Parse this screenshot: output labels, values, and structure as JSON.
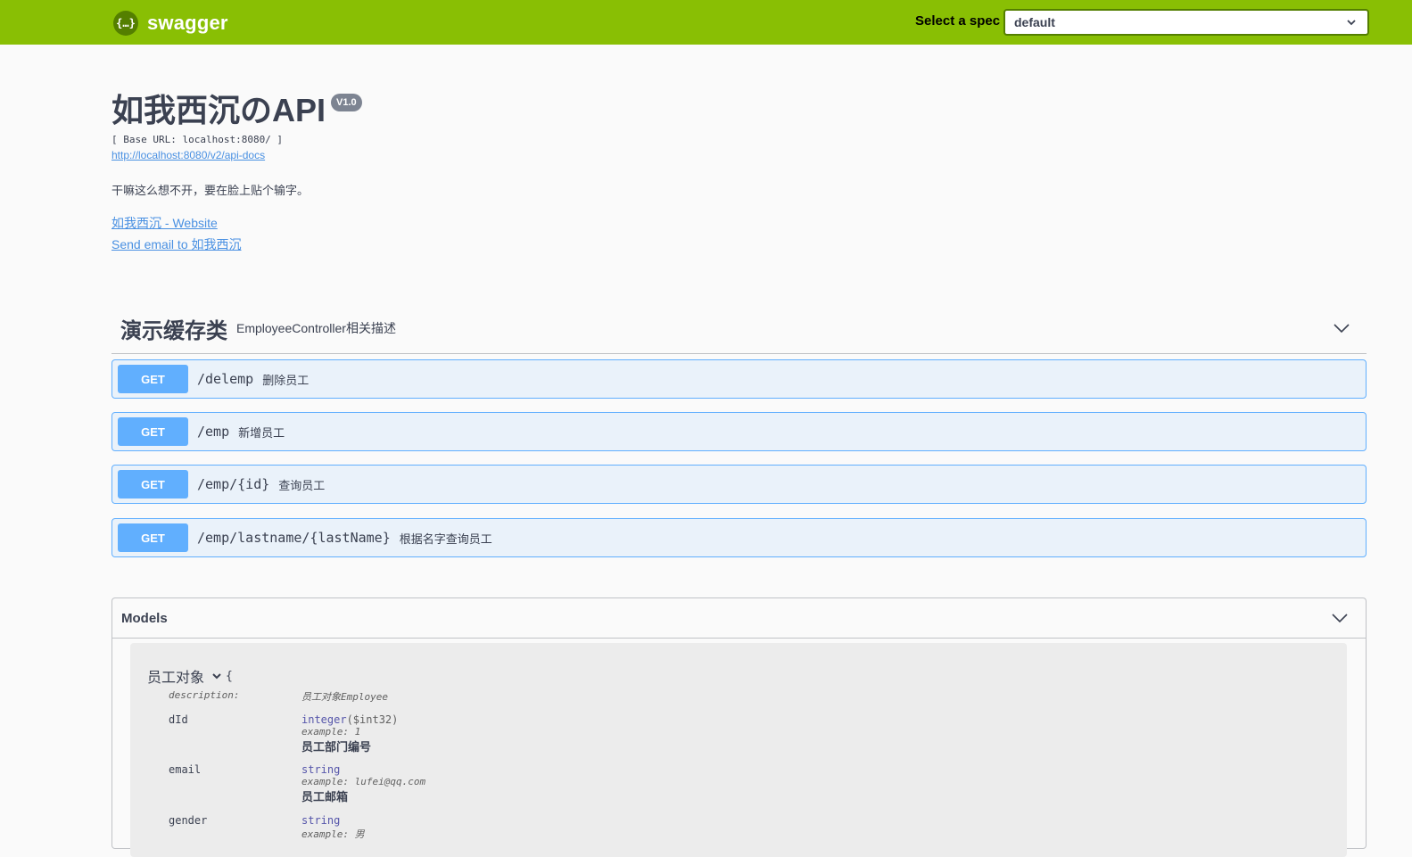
{
  "topbar": {
    "logo_symbol": "{…}",
    "logo_text": "swagger",
    "spec_label": "Select a spec",
    "spec_value": "default"
  },
  "info": {
    "title": "如我西沉のAPI",
    "version": "V1.0",
    "base_url": "[ Base URL: localhost:8080/ ]",
    "api_docs_link": "http://localhost:8080/v2/api-docs",
    "description": "干嘛这么想不开，要在脸上贴个输字。",
    "website_link": "如我西沉 - Website",
    "email_link": "Send email to 如我西沉"
  },
  "tag": {
    "name": "演示缓存类",
    "description": "EmployeeController相关描述"
  },
  "operations": [
    {
      "method": "GET",
      "path": "/delemp",
      "summary": "删除员工"
    },
    {
      "method": "GET",
      "path": "/emp",
      "summary": "新增员工"
    },
    {
      "method": "GET",
      "path": "/emp/{id}",
      "summary": "查询员工"
    },
    {
      "method": "GET",
      "path": "/emp/lastname/{lastName}",
      "summary": "根据名字查询员工"
    }
  ],
  "models": {
    "title": "Models",
    "model": {
      "name": "员工对象",
      "brace": "{",
      "description_label": "description:",
      "description_value": "员工对象Employee",
      "properties": [
        {
          "name": "dId",
          "type": "integer",
          "format": "($int32)",
          "example": "example: 1",
          "desc": "员工部门编号"
        },
        {
          "name": "email",
          "type": "string",
          "format": "",
          "example": "example: lufei@qq.com",
          "desc": "员工邮箱"
        },
        {
          "name": "gender",
          "type": "string",
          "format": "",
          "example": "example: 男",
          "desc": ""
        }
      ]
    }
  },
  "colors": {
    "topbar": "#89bf04",
    "get": "#61affe",
    "link": "#4990e2"
  }
}
